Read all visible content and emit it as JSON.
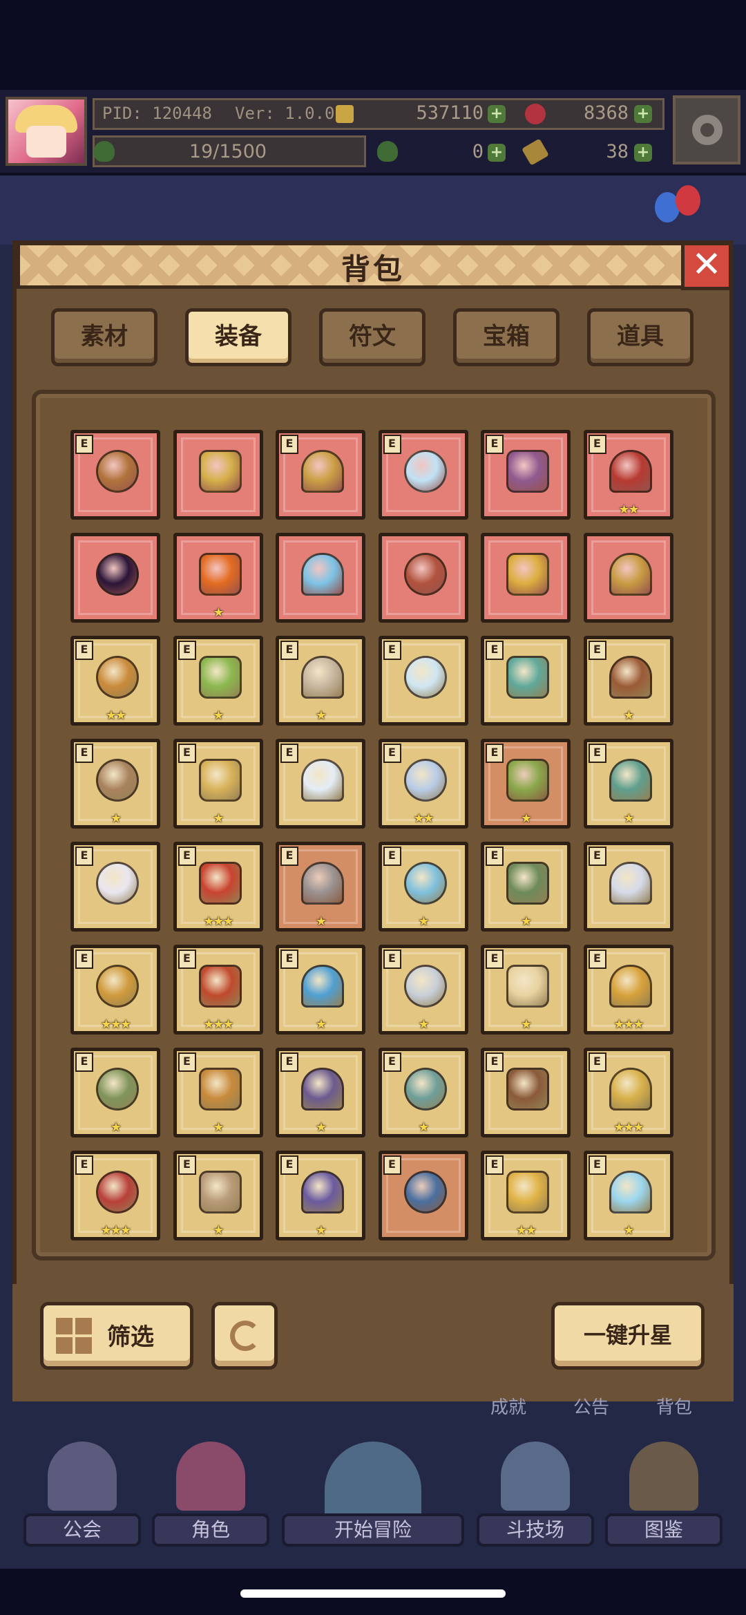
{
  "hud": {
    "pid": "PID: 120448",
    "version": "Ver: 1.0.0.9",
    "gold": "537110",
    "gems": "8368",
    "exp": "19/1500",
    "clover": "0",
    "keys": "38"
  },
  "bag": {
    "title": "背包",
    "close_label": "✕",
    "tabs": [
      "素材",
      "装备",
      "符文",
      "宝箱",
      "道具"
    ],
    "active_tab": "装备"
  },
  "items": [
    {
      "icon": "staff-icon",
      "quality": "red",
      "stars": "",
      "e": true
    },
    {
      "icon": "straw-hat-icon",
      "quality": "red",
      "stars": "",
      "e": false
    },
    {
      "icon": "horned-helmet-icon",
      "quality": "red",
      "stars": "",
      "e": true
    },
    {
      "icon": "crystal-necklace-icon",
      "quality": "red",
      "stars": "",
      "e": true
    },
    {
      "icon": "pendant-necklace-icon",
      "quality": "red",
      "stars": "",
      "e": true
    },
    {
      "icon": "red-crown-icon",
      "quality": "red",
      "stars": "★★",
      "e": true
    },
    {
      "icon": "dark-orb-icon",
      "quality": "red",
      "stars": "",
      "e": false
    },
    {
      "icon": "fire-ring-icon",
      "quality": "red",
      "stars": "★",
      "e": false
    },
    {
      "icon": "ice-helmet-icon",
      "quality": "red",
      "stars": "",
      "e": false
    },
    {
      "icon": "flesh-armor-icon",
      "quality": "red",
      "stars": "",
      "e": false
    },
    {
      "icon": "gold-amulet-icon",
      "quality": "red",
      "stars": "",
      "e": false
    },
    {
      "icon": "gold-ring-icon",
      "quality": "red",
      "stars": "",
      "e": false
    },
    {
      "icon": "golden-scepter-icon",
      "quality": "gold",
      "stars": "★★",
      "e": true
    },
    {
      "icon": "green-mace-icon",
      "quality": "gold",
      "stars": "★",
      "e": true
    },
    {
      "icon": "bone-axe-icon",
      "quality": "gold",
      "stars": "★",
      "e": true
    },
    {
      "icon": "ice-wand-icon",
      "quality": "gold",
      "stars": "",
      "e": true
    },
    {
      "icon": "jade-spear-icon",
      "quality": "gold",
      "stars": "",
      "e": true
    },
    {
      "icon": "viking-shield-icon",
      "quality": "gold",
      "stars": "★",
      "e": true
    },
    {
      "icon": "round-shield-icon",
      "quality": "gold",
      "stars": "★",
      "e": true
    },
    {
      "icon": "holy-shield-icon",
      "quality": "gold",
      "stars": "★",
      "e": true
    },
    {
      "icon": "pearl-orb-icon",
      "quality": "gold",
      "stars": "",
      "e": true
    },
    {
      "icon": "crystal-crown-icon",
      "quality": "gold",
      "stars": "★★",
      "e": true
    },
    {
      "icon": "green-mask-icon",
      "quality": "copper",
      "stars": "★",
      "e": true
    },
    {
      "icon": "teal-helmet-icon",
      "quality": "gold",
      "stars": "★",
      "e": true
    },
    {
      "icon": "white-hood-icon",
      "quality": "gold",
      "stars": "",
      "e": true
    },
    {
      "icon": "royal-cape-icon",
      "quality": "gold",
      "stars": "★★★",
      "e": true
    },
    {
      "icon": "stone-armor-icon",
      "quality": "copper",
      "stars": "★",
      "e": true
    },
    {
      "icon": "ice-robe-icon",
      "quality": "gold",
      "stars": "★",
      "e": true
    },
    {
      "icon": "green-cloak-icon",
      "quality": "gold",
      "stars": "★",
      "e": true
    },
    {
      "icon": "winged-armor-icon",
      "quality": "gold",
      "stars": "",
      "e": true
    },
    {
      "icon": "ruby-gauntlet-icon",
      "quality": "gold",
      "stars": "★★★",
      "e": true
    },
    {
      "icon": "fire-gauntlet-icon",
      "quality": "gold",
      "stars": "★★★",
      "e": true
    },
    {
      "icon": "blue-glove-icon",
      "quality": "gold",
      "stars": "★",
      "e": true
    },
    {
      "icon": "claw-glove-icon",
      "quality": "gold",
      "stars": "★",
      "e": true
    },
    {
      "icon": "angel-bracer-icon",
      "quality": "gold",
      "stars": "★",
      "e": true
    },
    {
      "icon": "ruby-belt-icon",
      "quality": "gold",
      "stars": "★★★",
      "e": true
    },
    {
      "icon": "jade-belt-icon",
      "quality": "gold",
      "stars": "★",
      "e": true
    },
    {
      "icon": "gold-belt-icon",
      "quality": "gold",
      "stars": "★",
      "e": true
    },
    {
      "icon": "purple-belt-icon",
      "quality": "gold",
      "stars": "★",
      "e": true
    },
    {
      "icon": "teal-belt-icon",
      "quality": "gold",
      "stars": "★",
      "e": true
    },
    {
      "icon": "gem-belt-icon",
      "quality": "gold",
      "stars": "",
      "e": true
    },
    {
      "icon": "gold-boots-icon",
      "quality": "gold",
      "stars": "★★★",
      "e": true
    },
    {
      "icon": "red-boots-icon",
      "quality": "gold",
      "stars": "★★★",
      "e": true
    },
    {
      "icon": "leather-boots-icon",
      "quality": "gold",
      "stars": "★",
      "e": true
    },
    {
      "icon": "purple-boots-icon",
      "quality": "gold",
      "stars": "★",
      "e": true
    },
    {
      "icon": "blue-boots-icon",
      "quality": "copper",
      "stars": "",
      "e": true
    },
    {
      "icon": "gold-emblem-icon",
      "quality": "gold",
      "stars": "★★",
      "e": true
    },
    {
      "icon": "ice-crystal-icon",
      "quality": "gold",
      "stars": "★",
      "e": true
    }
  ],
  "icon_colors": {
    "staff-icon": "#b0733b",
    "straw-hat-icon": "#d4b04a",
    "horned-helmet-icon": "#caa045",
    "crystal-necklace-icon": "#bfe2f5",
    "pendant-necklace-icon": "#8f5a8f",
    "red-crown-icon": "#b63b32",
    "dark-orb-icon": "#2a1538",
    "fire-ring-icon": "#e36b21",
    "ice-helmet-icon": "#7cc4e6",
    "flesh-armor-icon": "#b0533e",
    "gold-amulet-icon": "#dcae3f",
    "gold-ring-icon": "#c79c42",
    "golden-scepter-icon": "#c98a3a",
    "green-mace-icon": "#8cb84f",
    "bone-axe-icon": "#c8b6a0",
    "ice-wand-icon": "#cfe6f3",
    "jade-spear-icon": "#5fa89a",
    "viking-shield-icon": "#9b5a36",
    "round-shield-icon": "#a8825d",
    "holy-shield-icon": "#d8b25a",
    "pearl-orb-icon": "#e4ecf6",
    "crystal-crown-icon": "#b8cce8",
    "green-mask-icon": "#8aa84b",
    "teal-helmet-icon": "#5f9e8e",
    "white-hood-icon": "#e9e6f0",
    "royal-cape-icon": "#c9432f",
    "stone-armor-icon": "#9a9292",
    "ice-robe-icon": "#7fc0dd",
    "green-cloak-icon": "#6d8a5a",
    "winged-armor-icon": "#d6dbea",
    "ruby-gauntlet-icon": "#cf9a3c",
    "fire-gauntlet-icon": "#c0492d",
    "blue-glove-icon": "#4f9fd2",
    "claw-glove-icon": "#c8cfd8",
    "angel-bracer-icon": "#e8d2a0",
    "ruby-belt-icon": "#d7a13a",
    "jade-belt-icon": "#7f945a",
    "gold-belt-icon": "#c88a3c",
    "purple-belt-icon": "#6b5a8f",
    "teal-belt-icon": "#6e9e9a",
    "gem-belt-icon": "#8a5a3a",
    "gold-boots-icon": "#d8b04a",
    "red-boots-icon": "#b8403a",
    "leather-boots-icon": "#b89a78",
    "purple-boots-icon": "#6a5aa0",
    "blue-boots-icon": "#4a6fa0",
    "gold-emblem-icon": "#e0b246",
    "ice-crystal-icon": "#9ad6ee"
  },
  "actions": {
    "filter_label": "筛选",
    "upgrade_label": "一键升星"
  },
  "under_labels": [
    "成就",
    "公告",
    "背包"
  ],
  "nav": [
    "公会",
    "角色",
    "开始冒险",
    "斗技场",
    "图鉴"
  ],
  "colors": {
    "quality_red": "#e47f78",
    "quality_gold": "#e3c682",
    "quality_copper": "#d48e66",
    "panel_brown": "#6b5237",
    "active_tab": "#f4dfad"
  }
}
